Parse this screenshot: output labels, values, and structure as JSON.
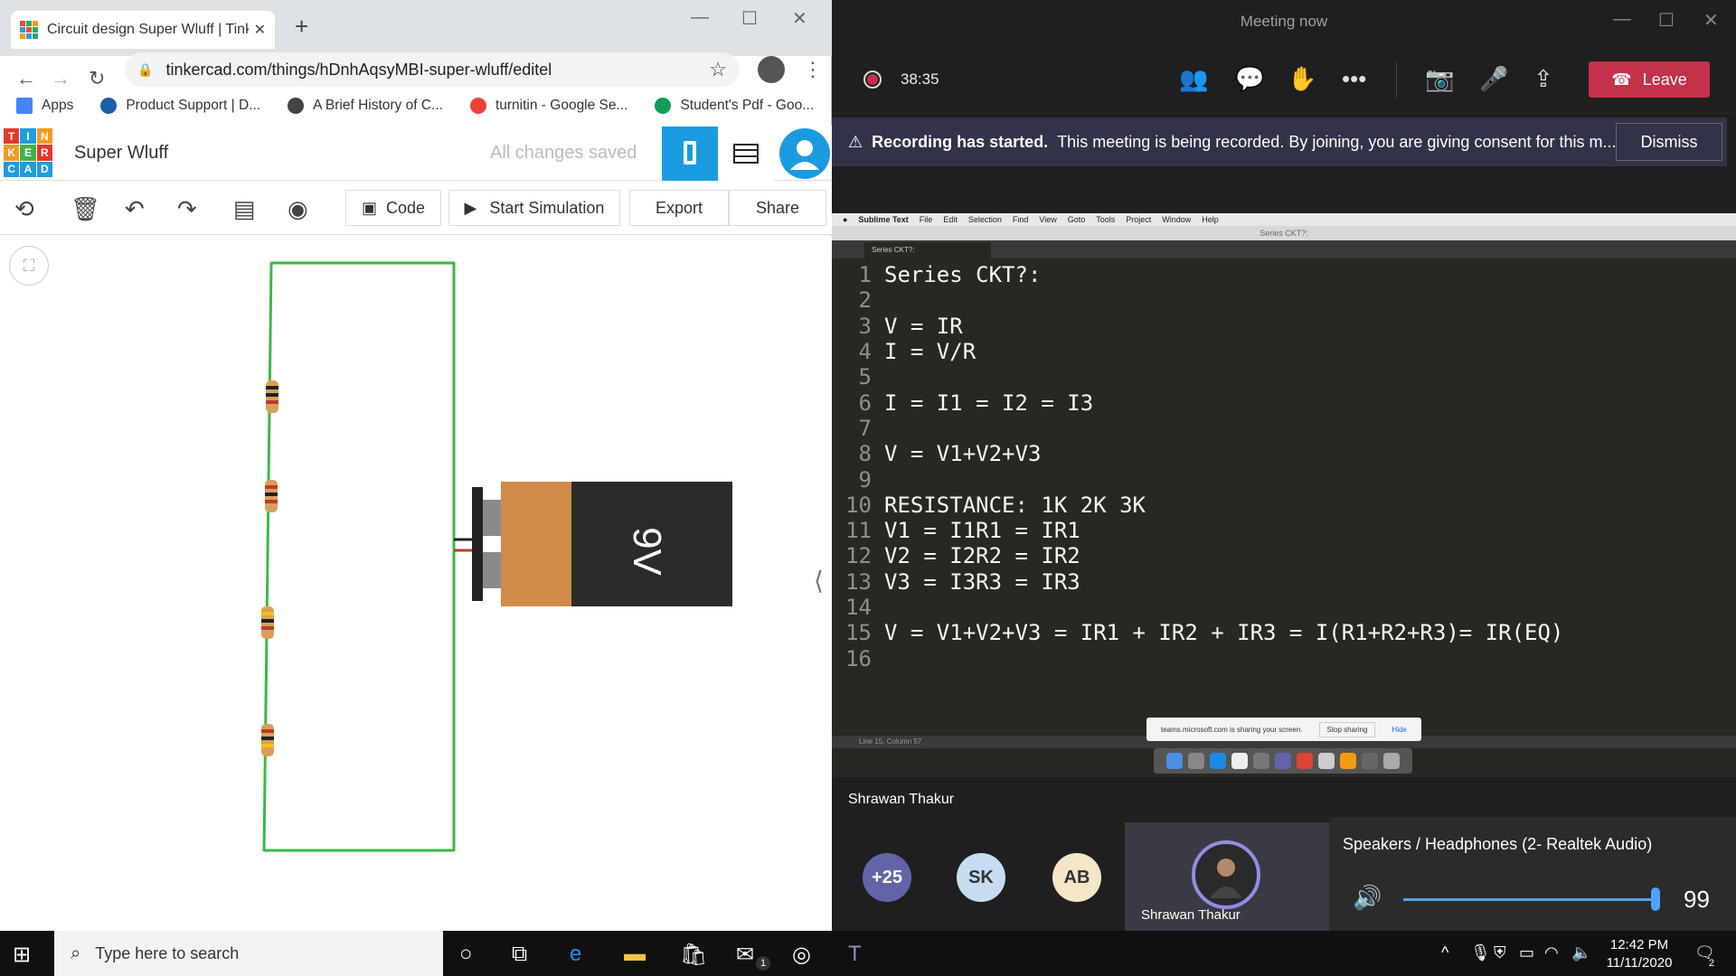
{
  "browser": {
    "tab_title": "Circuit design Super Wluff | Tinke",
    "url": "tinkercad.com/things/hDnhAqsyMBI-super-wluff/editel",
    "bookmarks": [
      {
        "label": "Apps",
        "color": "#4285f4"
      },
      {
        "label": "Product Support | D...",
        "color": "#1a5fa8"
      },
      {
        "label": "A Brief History of C...",
        "color": "#444444"
      },
      {
        "label": "turnitin - Google Se...",
        "color": "#ea4335"
      },
      {
        "label": "Student's Pdf - Goo...",
        "color": "#0f9d58"
      }
    ],
    "more_label": "»"
  },
  "tinkercad": {
    "logo": [
      "T",
      "I",
      "N",
      "K",
      "E",
      "R",
      "C",
      "A",
      "D"
    ],
    "project_name": "Super Wluff",
    "save_status": "All changes saved",
    "code_label": "Code",
    "sim_label": "Start Simulation",
    "export_label": "Export",
    "share_label": "Share",
    "battery_label": "9V",
    "wire_color": "#3cb846"
  },
  "teams": {
    "window_title": "Meeting now",
    "timer": "38:35",
    "leave_label": "Leave",
    "banner_bold": "Recording has started.",
    "banner_text": "This meeting is being recorded. By joining, you are giving consent for this m...",
    "dismiss_label": "Dismiss",
    "presenter_name": "Shrawan Thakur",
    "participants": [
      {
        "label": "+25",
        "bg": "#6264a7",
        "fg": "#ffffff"
      },
      {
        "label": "SK",
        "bg": "#c7dcf3",
        "fg": "#333333"
      },
      {
        "label": "AB",
        "bg": "#f5e6c8",
        "fg": "#333333"
      }
    ],
    "video_name": "Shrawan Thakur"
  },
  "sublime": {
    "menu": [
      "Sublime Text",
      "File",
      "Edit",
      "Selection",
      "Find",
      "View",
      "Goto",
      "Tools",
      "Project",
      "Window",
      "Help"
    ],
    "window_title": "Series CKT?:",
    "tab_title": "Series CKT?:",
    "lines": [
      "Series CKT?:",
      "",
      "V = IR",
      "I = V/R",
      "",
      "I = I1 = I2 = I3",
      "",
      "V = V1+V2+V3",
      "",
      "RESISTANCE: 1K 2K 3K",
      "V1 = I1R1 = IR1",
      "V2 = I2R2 = IR2",
      "V3 = I3R3 = IR3",
      "",
      "V = V1+V2+V3 = IR1 + IR2 + IR3 = I(R1+R2+R3)= IR(EQ)",
      ""
    ],
    "share_msg": "teams.microsoft.com is sharing your screen.",
    "stop_sharing": "Stop sharing",
    "hide": "Hide",
    "status": "Line 15, Column 57"
  },
  "volume": {
    "device": "Speakers / Headphones (2- Realtek Audio)",
    "level": 99
  },
  "taskbar": {
    "search_placeholder": "Type here to search",
    "time": "12:42 PM",
    "date": "11/11/2020",
    "notif_count": "2",
    "mail_badge": "1"
  }
}
